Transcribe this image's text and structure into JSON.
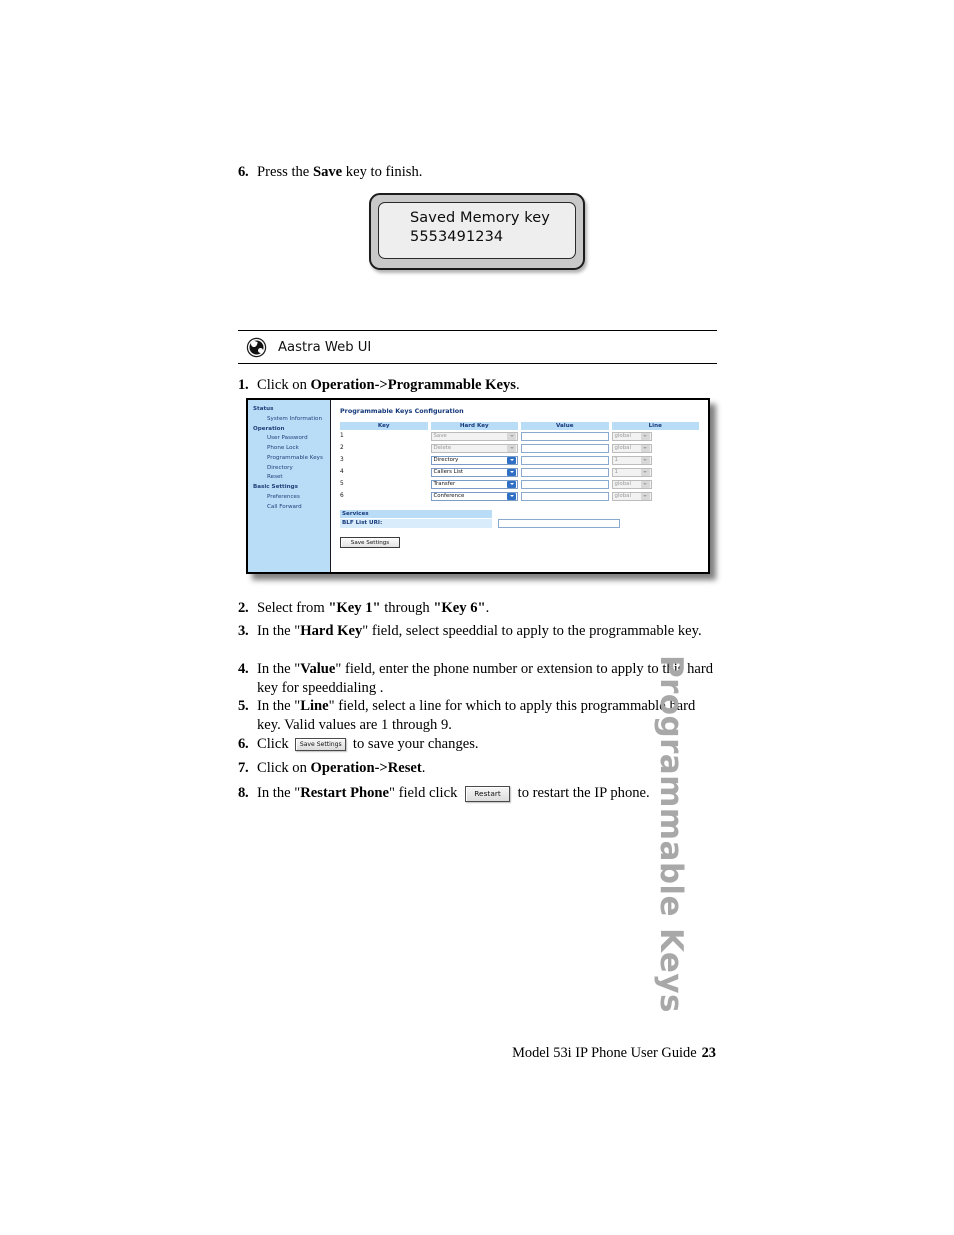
{
  "steps_top": [
    {
      "num": "6.",
      "html_key": "press_save"
    }
  ],
  "step6_top": {
    "num": "6.",
    "text_before": "Press the ",
    "bold": "Save",
    "text_after": " key to finish."
  },
  "phone_display": {
    "line1": "Saved Memory key",
    "line2": "5553491234"
  },
  "ui_band": {
    "icon": "globe-icon",
    "label": "Aastra Web UI"
  },
  "step1": {
    "num": "1.",
    "text_before": "Click on ",
    "bold": "Operation->Programmable Keys",
    "text_after": "."
  },
  "webui": {
    "sidebar": [
      {
        "label": "Status",
        "type": "header"
      },
      {
        "label": "System Information",
        "type": "item"
      },
      {
        "label": "Operation",
        "type": "header"
      },
      {
        "label": "User Password",
        "type": "item"
      },
      {
        "label": "Phone Lock",
        "type": "item"
      },
      {
        "label": "Programmable Keys",
        "type": "item"
      },
      {
        "label": "Directory",
        "type": "item"
      },
      {
        "label": "Reset",
        "type": "item"
      },
      {
        "label": "Basic Settings",
        "type": "header"
      },
      {
        "label": "Preferences",
        "type": "item"
      },
      {
        "label": "Call Forward",
        "type": "item"
      }
    ],
    "title": "Programmable Keys Configuration",
    "columns": [
      "Key",
      "Hard Key",
      "Value",
      "Line"
    ],
    "rows": [
      {
        "key": "1",
        "hard_key": "Save",
        "value": "",
        "line": "global",
        "disabled": true
      },
      {
        "key": "2",
        "hard_key": "Delete",
        "value": "",
        "line": "global",
        "disabled": true
      },
      {
        "key": "3",
        "hard_key": "Directory",
        "value": "",
        "line": "1",
        "disabled": false
      },
      {
        "key": "4",
        "hard_key": "Callers List",
        "value": "",
        "line": "1",
        "disabled": false
      },
      {
        "key": "5",
        "hard_key": "Transfer",
        "value": "",
        "line": "global",
        "disabled": false
      },
      {
        "key": "6",
        "hard_key": "Conference",
        "value": "",
        "line": "global",
        "disabled": false
      }
    ],
    "services_header": "Services",
    "blf_label": "BLF List URI:",
    "blf_value": "",
    "save_button": "Save Settings"
  },
  "step2": {
    "num": "2.",
    "p1": "Select from ",
    "b1": "\"Key 1\"",
    "p2": " through ",
    "b2": "\"Key 6\"",
    "p3": "."
  },
  "step3": {
    "num": "3.",
    "p1": "In the \"",
    "b1": "Hard Key",
    "p2": "\" field, select speeddial to apply to the programmable key."
  },
  "step4": {
    "num": "4.",
    "p1": "In the \"",
    "b1": "Value",
    "p2": "\" field, enter the phone number or extension to apply to this hard key for speeddialing ."
  },
  "step5": {
    "num": "5.",
    "p1": "In the \"",
    "b1": "Line",
    "p2": "\" field, select a line for which to apply this programmable hard key. Valid values are 1 through 9."
  },
  "step6": {
    "num": "6.",
    "p1": "Click ",
    "button": "Save Settings",
    "p2": " to save your changes."
  },
  "step7": {
    "num": "7.",
    "p1": "Click on ",
    "b1": "Operation->Reset",
    "p2": "."
  },
  "step8": {
    "num": "8.",
    "p1": "In the \"",
    "b1": "Restart Phone",
    "p2": "\" field click ",
    "button": "Restart",
    "p3": " to restart the IP phone."
  },
  "side_tab": "Programmable Keys",
  "footer": {
    "title": "Model 53i IP Phone User Guide",
    "page": "23"
  },
  "colors": {
    "sidebar_blue": "#b9ddf7",
    "header_blue": "#b9ddf7",
    "label_blue_light": "#d8ecfb",
    "text_blue": "#15387a",
    "side_tab_grey": "#a8a8a8"
  }
}
